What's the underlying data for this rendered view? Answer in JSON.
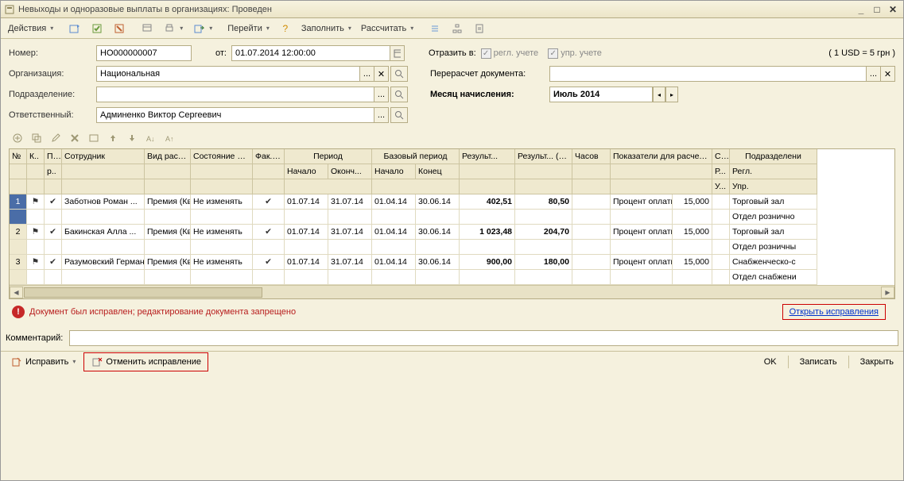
{
  "window_title": "Невыходы и одноразовые выплаты в организациях: Проведен",
  "toolbar": {
    "actions": "Действия",
    "navigate": "Перейти",
    "fill": "Заполнить",
    "calc": "Рассчитать"
  },
  "form": {
    "number_label": "Номер:",
    "number_value": "НО000000007",
    "from_label": "от:",
    "date_value": "01.07.2014 12:00:00",
    "reflect_label": "Отразить в:",
    "reg_label": "регл. учете",
    "mgmt_label": "упр. учете",
    "rate": "( 1 USD = 5 грн )",
    "org_label": "Организация:",
    "org_value": "Национальная",
    "recalc_label": "Перерасчет документа:",
    "recalc_value": "",
    "dept_label": "Подразделение:",
    "dept_value": "",
    "month_label": "Месяц начисления:",
    "month_value": "Июль 2014",
    "resp_label": "Ответственный:",
    "resp_value": "Админенко Виктор Сергеевич"
  },
  "grid_headers": {
    "num": "№",
    "k": "К..",
    "p": "П а..",
    "employee": "Сотрудник",
    "calc_type": "Вид расче...",
    "worker_state": "Состояние работника",
    "fact": "Фак. про...",
    "period": "Период",
    "period_start": "Начало",
    "period_end": "Оконч...",
    "base_period": "Базовый период",
    "base_start": "Начало",
    "base_end": "Конец",
    "result": "Результ...",
    "result_mgmt": "Результ... (упр.)",
    "hours": "Часов",
    "indicators": "Показатели для расчета начисления",
    "s": "С...",
    "department": "Подразделени",
    "r": "Р...",
    "regl": "Регл.",
    "u": "У...",
    "upr": "Упр."
  },
  "rows": [
    {
      "num": "1",
      "emp": "Заботнов Роман ...",
      "type": "Премия (Квар...",
      "state": "Не изменять",
      "p_start": "01.07.14",
      "p_end": "31.07.14",
      "b_start": "01.04.14",
      "b_end": "30.06.14",
      "res": "402,51",
      "res_m": "80,50",
      "ind": "Процент оплаты",
      "ind_v": "15,000",
      "dept1": "Торговый зал",
      "dept2": "Отдел рознично"
    },
    {
      "num": "2",
      "emp": "Бакинская Алла ...",
      "type": "Премия (Квар...",
      "state": "Не изменять",
      "p_start": "01.07.14",
      "p_end": "31.07.14",
      "b_start": "01.04.14",
      "b_end": "30.06.14",
      "res": "1 023,48",
      "res_m": "204,70",
      "ind": "Процент оплаты",
      "ind_v": "15,000",
      "dept1": "Торговый зал",
      "dept2": "Отдел розничны"
    },
    {
      "num": "3",
      "emp": "Разумовский Герман ...",
      "type": "Премия (Квар...",
      "state": "Не изменять",
      "p_start": "01.07.14",
      "p_end": "31.07.14",
      "b_start": "01.04.14",
      "b_end": "30.06.14",
      "res": "900,00",
      "res_m": "180,00",
      "ind": "Процент оплаты",
      "ind_v": "15,000",
      "dept1": "Снабженческо-с",
      "dept2": "Отдел снабжени"
    }
  ],
  "warning": {
    "text": "Документ был исправлен; редактирование документа запрещено",
    "link": "Открыть исправления"
  },
  "comment_label": "Комментарий:",
  "bottom": {
    "fix": "Исправить",
    "cancel_fix": "Отменить исправление",
    "ok": "OK",
    "write": "Записать",
    "close": "Закрыть"
  }
}
